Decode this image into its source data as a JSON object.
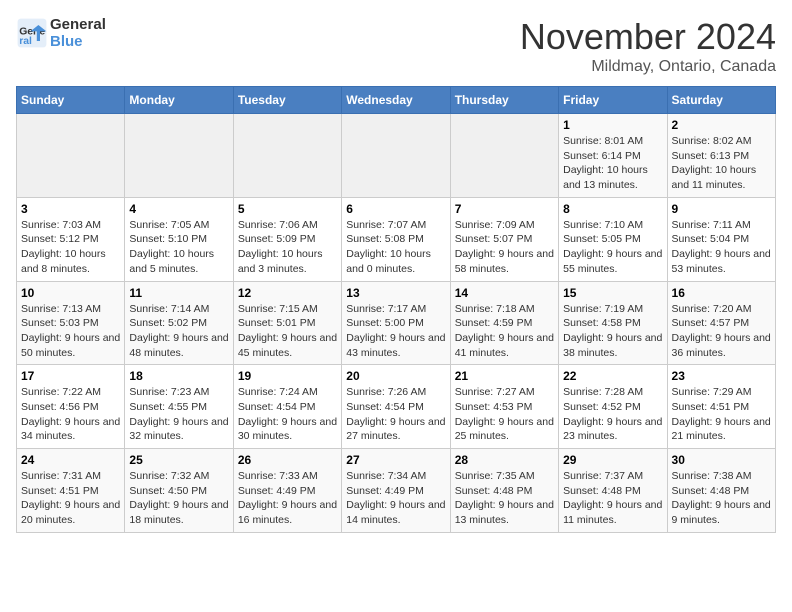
{
  "header": {
    "logo_line1": "General",
    "logo_line2": "Blue",
    "month": "November 2024",
    "location": "Mildmay, Ontario, Canada"
  },
  "days_of_week": [
    "Sunday",
    "Monday",
    "Tuesday",
    "Wednesday",
    "Thursday",
    "Friday",
    "Saturday"
  ],
  "weeks": [
    [
      {
        "day": "",
        "info": ""
      },
      {
        "day": "",
        "info": ""
      },
      {
        "day": "",
        "info": ""
      },
      {
        "day": "",
        "info": ""
      },
      {
        "day": "",
        "info": ""
      },
      {
        "day": "1",
        "info": "Sunrise: 8:01 AM\nSunset: 6:14 PM\nDaylight: 10 hours and 13 minutes."
      },
      {
        "day": "2",
        "info": "Sunrise: 8:02 AM\nSunset: 6:13 PM\nDaylight: 10 hours and 11 minutes."
      }
    ],
    [
      {
        "day": "3",
        "info": "Sunrise: 7:03 AM\nSunset: 5:12 PM\nDaylight: 10 hours and 8 minutes."
      },
      {
        "day": "4",
        "info": "Sunrise: 7:05 AM\nSunset: 5:10 PM\nDaylight: 10 hours and 5 minutes."
      },
      {
        "day": "5",
        "info": "Sunrise: 7:06 AM\nSunset: 5:09 PM\nDaylight: 10 hours and 3 minutes."
      },
      {
        "day": "6",
        "info": "Sunrise: 7:07 AM\nSunset: 5:08 PM\nDaylight: 10 hours and 0 minutes."
      },
      {
        "day": "7",
        "info": "Sunrise: 7:09 AM\nSunset: 5:07 PM\nDaylight: 9 hours and 58 minutes."
      },
      {
        "day": "8",
        "info": "Sunrise: 7:10 AM\nSunset: 5:05 PM\nDaylight: 9 hours and 55 minutes."
      },
      {
        "day": "9",
        "info": "Sunrise: 7:11 AM\nSunset: 5:04 PM\nDaylight: 9 hours and 53 minutes."
      }
    ],
    [
      {
        "day": "10",
        "info": "Sunrise: 7:13 AM\nSunset: 5:03 PM\nDaylight: 9 hours and 50 minutes."
      },
      {
        "day": "11",
        "info": "Sunrise: 7:14 AM\nSunset: 5:02 PM\nDaylight: 9 hours and 48 minutes."
      },
      {
        "day": "12",
        "info": "Sunrise: 7:15 AM\nSunset: 5:01 PM\nDaylight: 9 hours and 45 minutes."
      },
      {
        "day": "13",
        "info": "Sunrise: 7:17 AM\nSunset: 5:00 PM\nDaylight: 9 hours and 43 minutes."
      },
      {
        "day": "14",
        "info": "Sunrise: 7:18 AM\nSunset: 4:59 PM\nDaylight: 9 hours and 41 minutes."
      },
      {
        "day": "15",
        "info": "Sunrise: 7:19 AM\nSunset: 4:58 PM\nDaylight: 9 hours and 38 minutes."
      },
      {
        "day": "16",
        "info": "Sunrise: 7:20 AM\nSunset: 4:57 PM\nDaylight: 9 hours and 36 minutes."
      }
    ],
    [
      {
        "day": "17",
        "info": "Sunrise: 7:22 AM\nSunset: 4:56 PM\nDaylight: 9 hours and 34 minutes."
      },
      {
        "day": "18",
        "info": "Sunrise: 7:23 AM\nSunset: 4:55 PM\nDaylight: 9 hours and 32 minutes."
      },
      {
        "day": "19",
        "info": "Sunrise: 7:24 AM\nSunset: 4:54 PM\nDaylight: 9 hours and 30 minutes."
      },
      {
        "day": "20",
        "info": "Sunrise: 7:26 AM\nSunset: 4:54 PM\nDaylight: 9 hours and 27 minutes."
      },
      {
        "day": "21",
        "info": "Sunrise: 7:27 AM\nSunset: 4:53 PM\nDaylight: 9 hours and 25 minutes."
      },
      {
        "day": "22",
        "info": "Sunrise: 7:28 AM\nSunset: 4:52 PM\nDaylight: 9 hours and 23 minutes."
      },
      {
        "day": "23",
        "info": "Sunrise: 7:29 AM\nSunset: 4:51 PM\nDaylight: 9 hours and 21 minutes."
      }
    ],
    [
      {
        "day": "24",
        "info": "Sunrise: 7:31 AM\nSunset: 4:51 PM\nDaylight: 9 hours and 20 minutes."
      },
      {
        "day": "25",
        "info": "Sunrise: 7:32 AM\nSunset: 4:50 PM\nDaylight: 9 hours and 18 minutes."
      },
      {
        "day": "26",
        "info": "Sunrise: 7:33 AM\nSunset: 4:49 PM\nDaylight: 9 hours and 16 minutes."
      },
      {
        "day": "27",
        "info": "Sunrise: 7:34 AM\nSunset: 4:49 PM\nDaylight: 9 hours and 14 minutes."
      },
      {
        "day": "28",
        "info": "Sunrise: 7:35 AM\nSunset: 4:48 PM\nDaylight: 9 hours and 13 minutes."
      },
      {
        "day": "29",
        "info": "Sunrise: 7:37 AM\nSunset: 4:48 PM\nDaylight: 9 hours and 11 minutes."
      },
      {
        "day": "30",
        "info": "Sunrise: 7:38 AM\nSunset: 4:48 PM\nDaylight: 9 hours and 9 minutes."
      }
    ]
  ]
}
